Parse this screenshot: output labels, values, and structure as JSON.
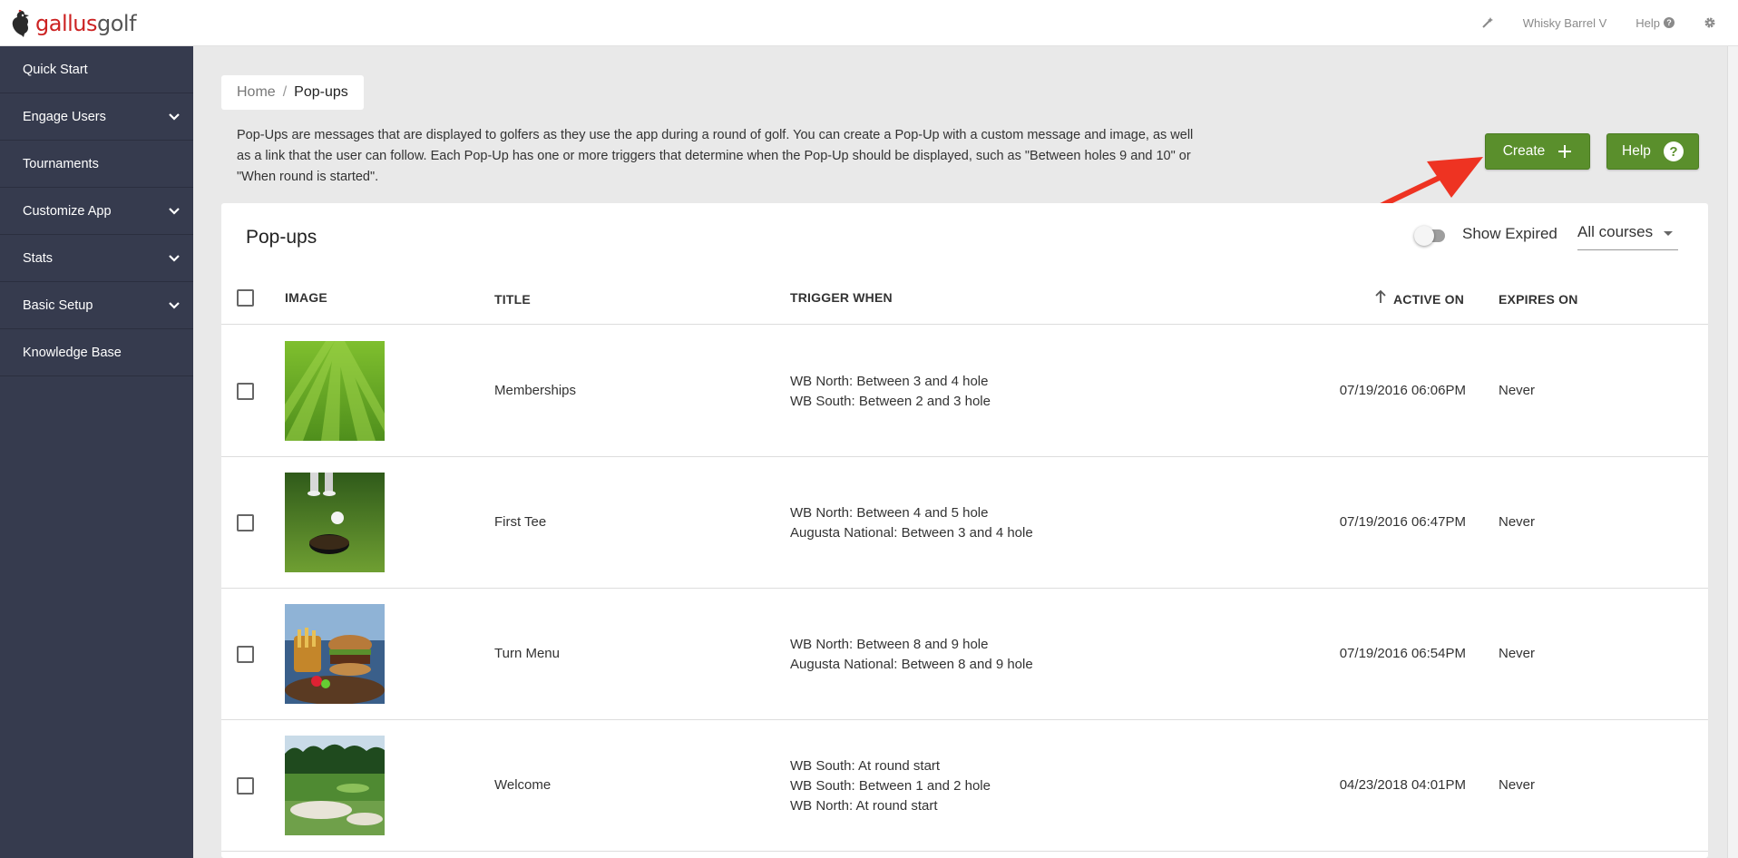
{
  "topbar": {
    "logo_part1": "gallus",
    "logo_part2": "golf",
    "course_name": "Whisky Barrel V",
    "help_label": "Help",
    "help_glyph": "?"
  },
  "sidebar": {
    "items": [
      {
        "label": "Quick Start",
        "has_children": false
      },
      {
        "label": "Engage Users",
        "has_children": true
      },
      {
        "label": "Tournaments",
        "has_children": false
      },
      {
        "label": "Customize App",
        "has_children": true
      },
      {
        "label": "Stats",
        "has_children": true
      },
      {
        "label": "Basic Setup",
        "has_children": true
      },
      {
        "label": "Knowledge Base",
        "has_children": false
      }
    ]
  },
  "breadcrumb": {
    "home": "Home",
    "separator": "/",
    "current": "Pop-ups"
  },
  "description": "Pop-Ups are messages that are displayed to golfers as they use the app during a round of golf. You can create a Pop-Up with a custom message and image, as well as a link that the user can follow. Each Pop-Up has one or more triggers that determine when the Pop-Up should be displayed, such as \"Between holes 9 and 10\" or \"When round is started\".",
  "actions": {
    "create_label": "Create",
    "help_label": "Help",
    "help_glyph": "?"
  },
  "card": {
    "title": "Pop-ups",
    "show_expired_label": "Show Expired",
    "show_expired_on": false,
    "course_filter": "All courses"
  },
  "table": {
    "headers": {
      "image": "IMAGE",
      "title": "TITLE",
      "trigger": "TRIGGER WHEN",
      "active": "ACTIVE ON",
      "expires": "EXPIRES ON"
    },
    "rows": [
      {
        "title": "Memberships",
        "image": "striped-fairway-grass",
        "triggers": [
          "WB North: Between 3 and 4 hole",
          "WB South: Between 2 and 3 hole"
        ],
        "active_on": "07/19/2016 06:06PM",
        "expires_on": "Never"
      },
      {
        "title": "First Tee",
        "image": "golf-ball-near-cup",
        "triggers": [
          "WB North: Between 4 and 5 hole",
          "Augusta National: Between 3 and 4 hole"
        ],
        "active_on": "07/19/2016 06:47PM",
        "expires_on": "Never"
      },
      {
        "title": "Turn Menu",
        "image": "burger-and-fries",
        "triggers": [
          "WB North: Between 8 and 9 hole",
          "Augusta National: Between 8 and 9 hole"
        ],
        "active_on": "07/19/2016 06:54PM",
        "expires_on": "Never"
      },
      {
        "title": "Welcome",
        "image": "course-with-bunker",
        "triggers": [
          "WB South: At round start",
          "WB South: Between 1 and 2 hole",
          "WB North: At round start"
        ],
        "active_on": "04/23/2018 04:01PM",
        "expires_on": "Never"
      }
    ]
  },
  "colors": {
    "sidebar_bg": "#363b4e",
    "button_green": "#5a8f2c",
    "annotation_arrow": "#ee3322",
    "logo_red": "#cc2222"
  }
}
